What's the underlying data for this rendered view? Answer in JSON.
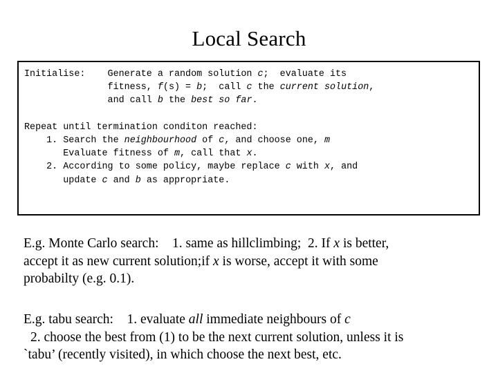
{
  "slide": {
    "title": "Local Search",
    "background_color": "#ffffff",
    "text_color": "#000000"
  },
  "codebox": {
    "border_color": "#000000",
    "lines": [
      {
        "id": "initialise-line-1",
        "segments": [
          {
            "text": "Initialise:    Generate a random solution ",
            "style": "normal"
          },
          {
            "text": "c",
            "style": "italic"
          },
          {
            "text": ";  evaluate its",
            "style": "normal"
          }
        ]
      },
      {
        "id": "initialise-line-2",
        "segments": [
          {
            "text": "               fitness, ",
            "style": "normal"
          },
          {
            "text": "f",
            "style": "italic"
          },
          {
            "text": "(s) = ",
            "style": "normal"
          },
          {
            "text": "b",
            "style": "italic"
          },
          {
            "text": ";  call ",
            "style": "normal"
          },
          {
            "text": "c",
            "style": "italic"
          },
          {
            "text": " the ",
            "style": "normal"
          },
          {
            "text": "current solution",
            "style": "italic"
          },
          {
            "text": ",",
            "style": "normal"
          }
        ]
      },
      {
        "id": "initialise-line-3",
        "segments": [
          {
            "text": "               and call ",
            "style": "normal"
          },
          {
            "text": "b",
            "style": "italic"
          },
          {
            "text": " the ",
            "style": "normal"
          },
          {
            "text": "best so far",
            "style": "italic"
          },
          {
            "text": ".",
            "style": "normal"
          }
        ]
      },
      {
        "id": "blank-line",
        "segments": [
          {
            "text": " ",
            "style": "normal"
          }
        ]
      },
      {
        "id": "repeat-line",
        "segments": [
          {
            "text": "Repeat until termination conditon reached:",
            "style": "normal"
          }
        ]
      },
      {
        "id": "step-1-line-1",
        "segments": [
          {
            "text": "    1. Search the ",
            "style": "normal"
          },
          {
            "text": "neighbourhood",
            "style": "italic"
          },
          {
            "text": " of ",
            "style": "normal"
          },
          {
            "text": "c",
            "style": "italic"
          },
          {
            "text": ", and choose one, ",
            "style": "normal"
          },
          {
            "text": "m",
            "style": "italic"
          }
        ]
      },
      {
        "id": "step-1-line-2",
        "segments": [
          {
            "text": "       Evaluate fitness of ",
            "style": "normal"
          },
          {
            "text": "m",
            "style": "italic"
          },
          {
            "text": ", call that ",
            "style": "normal"
          },
          {
            "text": "x",
            "style": "italic"
          },
          {
            "text": ".",
            "style": "normal"
          }
        ]
      },
      {
        "id": "step-2-line-1",
        "segments": [
          {
            "text": "    2. According to some policy, maybe replace ",
            "style": "normal"
          },
          {
            "text": "c",
            "style": "italic"
          },
          {
            "text": " with ",
            "style": "normal"
          },
          {
            "text": "x",
            "style": "italic"
          },
          {
            "text": ", and",
            "style": "normal"
          }
        ]
      },
      {
        "id": "step-2-line-2",
        "segments": [
          {
            "text": "       update ",
            "style": "normal"
          },
          {
            "text": "c",
            "style": "italic"
          },
          {
            "text": " and ",
            "style": "normal"
          },
          {
            "text": "b",
            "style": "italic"
          },
          {
            "text": " as appropriate.",
            "style": "normal"
          }
        ]
      }
    ]
  },
  "monte_carlo_paragraph": {
    "id": "monte-carlo",
    "lines": [
      {
        "id": "mc-line-1",
        "indent": false,
        "segments": [
          {
            "text": "E.g. Monte Carlo search:    1. same as hillclimbing;  2. If ",
            "style": "normal"
          },
          {
            "text": "x",
            "style": "italic"
          },
          {
            "text": " is better,",
            "style": "normal"
          }
        ]
      },
      {
        "id": "mc-line-2",
        "indent": false,
        "segments": [
          {
            "text": "accept it as new current solution;if ",
            "style": "normal"
          },
          {
            "text": "x",
            "style": "italic"
          },
          {
            "text": " is worse, accept it with some",
            "style": "normal"
          }
        ]
      },
      {
        "id": "mc-line-3",
        "indent": false,
        "segments": [
          {
            "text": "probabilty (e.g. 0.1).",
            "style": "normal"
          }
        ]
      }
    ]
  },
  "tabu_paragraph": {
    "id": "tabu-search",
    "lines": [
      {
        "id": "tabu-line-1",
        "indent": false,
        "segments": [
          {
            "text": "E.g. tabu search:    1. evaluate ",
            "style": "normal"
          },
          {
            "text": "all",
            "style": "italic"
          },
          {
            "text": " immediate neighbours of ",
            "style": "normal"
          },
          {
            "text": "c",
            "style": "italic"
          }
        ]
      },
      {
        "id": "tabu-line-2",
        "indent": true,
        "segments": [
          {
            "text": "2. choose the best from (1) to be the next current solution, unless it is",
            "style": "normal"
          }
        ]
      },
      {
        "id": "tabu-line-3",
        "indent": false,
        "segments": [
          {
            "text": "`tabu’ (recently visited), in which choose the next best, etc.",
            "style": "normal"
          }
        ]
      }
    ]
  }
}
